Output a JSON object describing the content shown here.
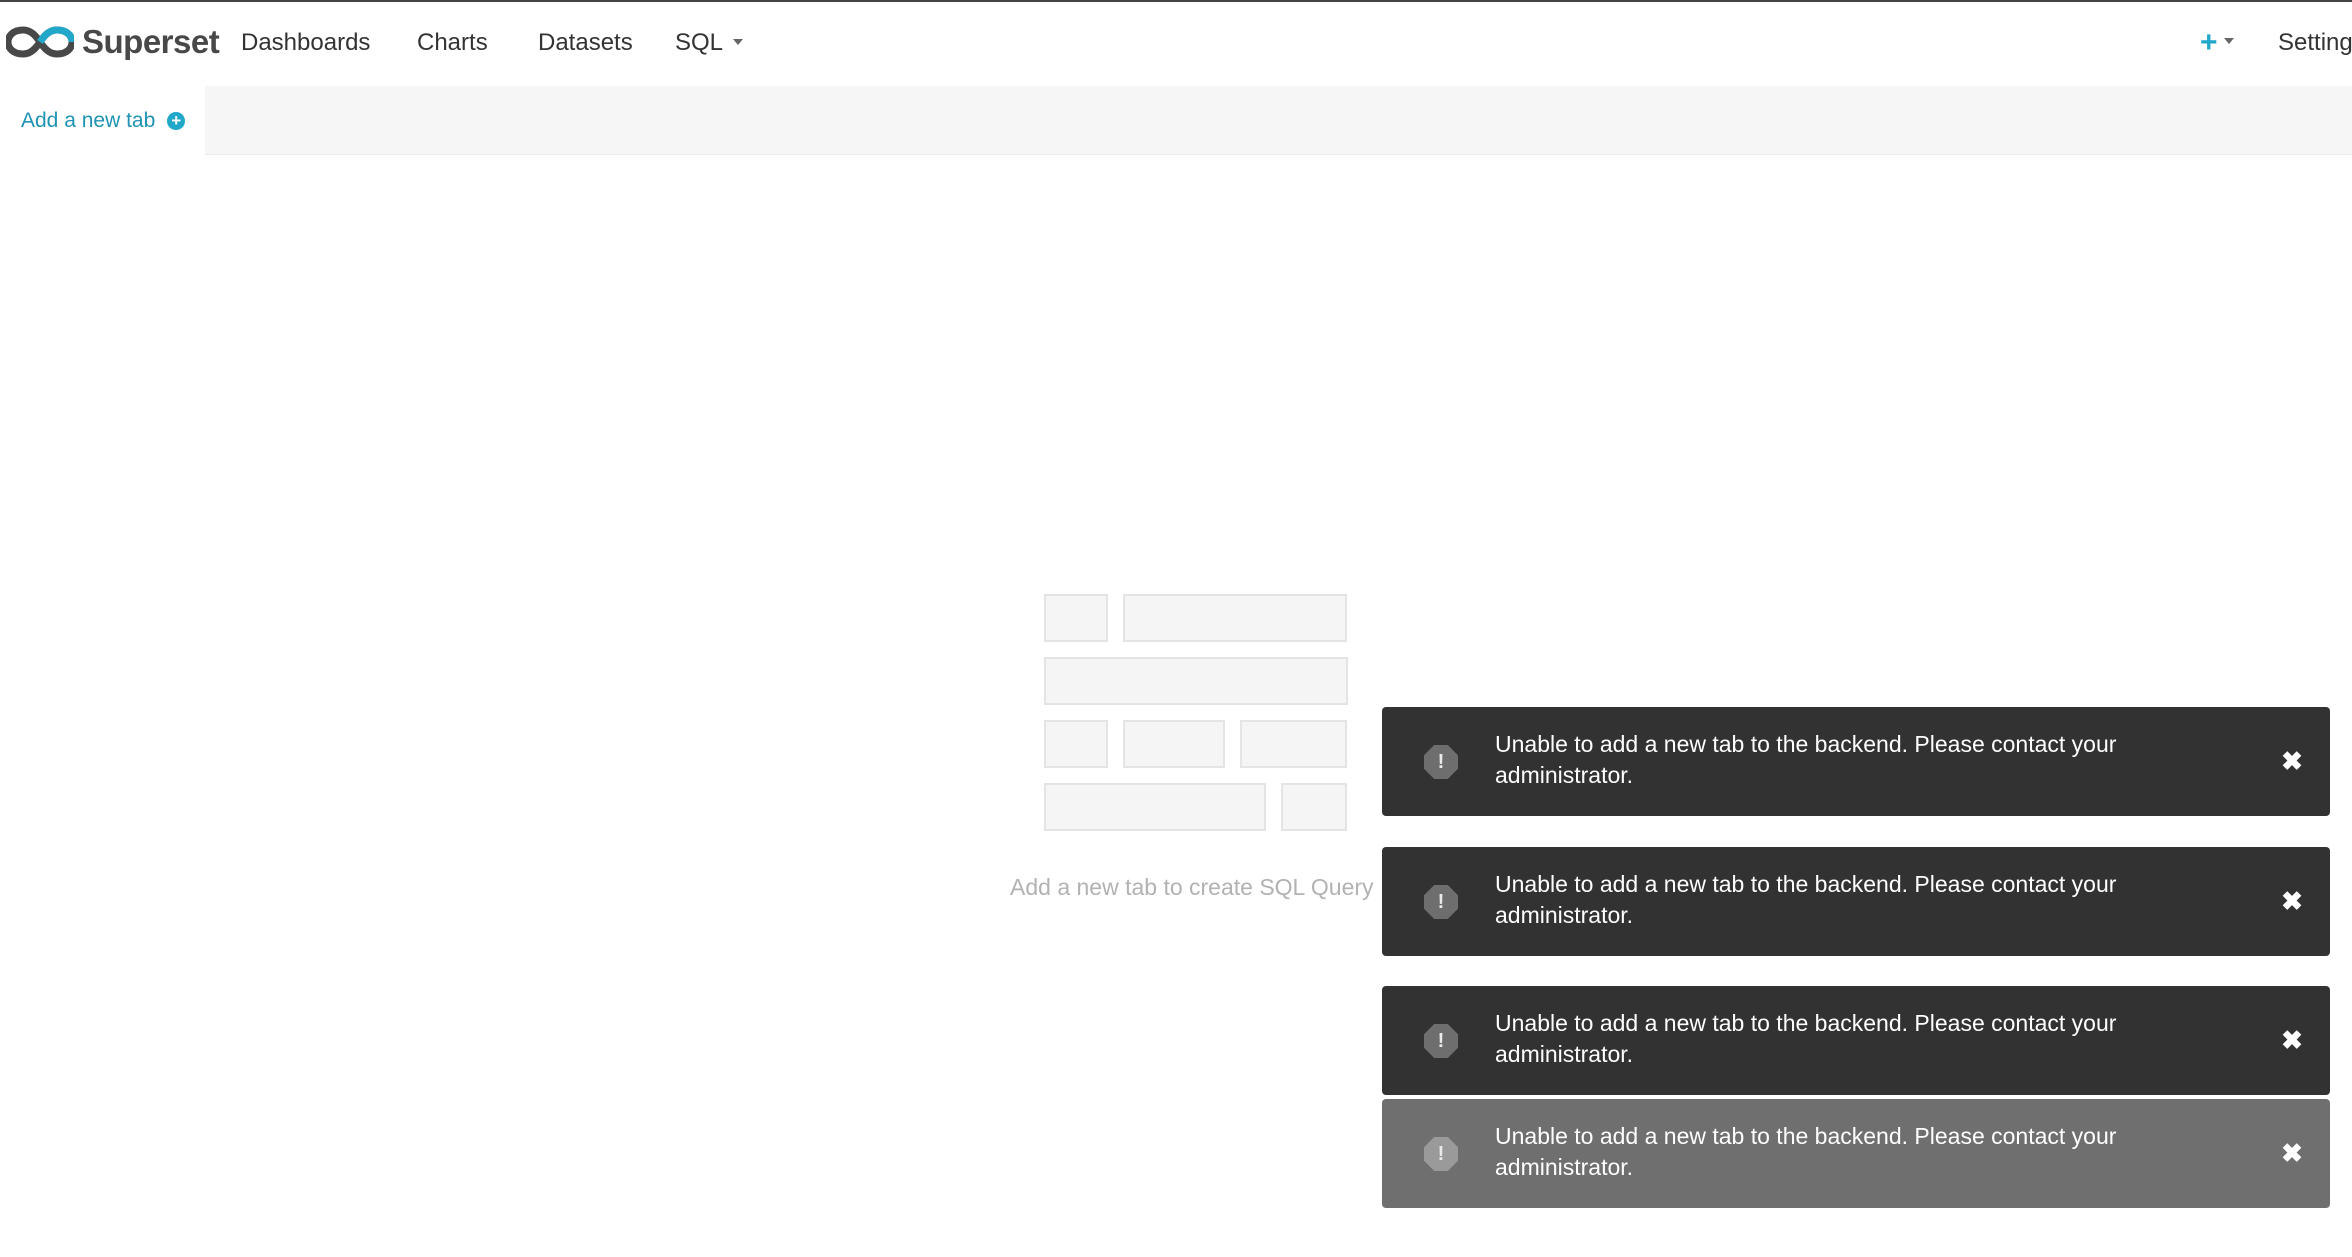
{
  "app": {
    "brand_name": "Superset",
    "logo_icon": "superset-infinity-logo-icon",
    "accent_color": "#20a7c9",
    "brand_color": "#484848"
  },
  "header": {
    "nav": [
      {
        "label": "Dashboards"
      },
      {
        "label": "Charts"
      },
      {
        "label": "Datasets"
      },
      {
        "label": "SQL",
        "icon": "caret-down-icon"
      }
    ],
    "plus_icon": "+",
    "settings_label": "Setting"
  },
  "tabs": {
    "add_label": "Add a new tab",
    "add_icon": "+"
  },
  "empty_state": {
    "message": "Add a new tab to create SQL Query"
  },
  "toasts": [
    {
      "message": "Unable to add a new tab to the backend. Please contact your administrator.",
      "icon": "!",
      "close": "✖",
      "state": "active"
    },
    {
      "message": "Unable to add a new tab to the backend. Please contact your administrator.",
      "icon": "!",
      "close": "✖",
      "state": "active"
    },
    {
      "message": "Unable to add a new tab to the backend. Please contact your administrator.",
      "icon": "!",
      "close": "✖",
      "state": "active"
    },
    {
      "message": "Unable to add a new tab to the backend. Please contact your administrator.",
      "icon": "!",
      "close": "✖",
      "state": "fading"
    }
  ]
}
